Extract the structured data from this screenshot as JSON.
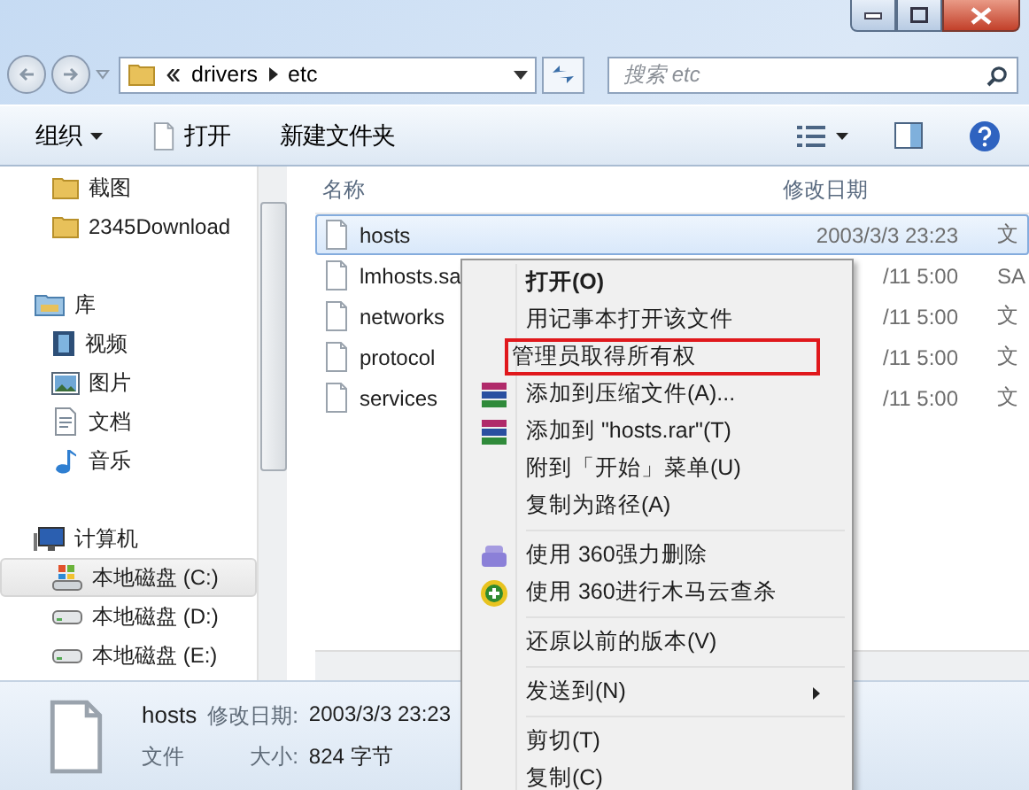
{
  "address_bar": {
    "path": [
      "drivers",
      "etc"
    ]
  },
  "search": {
    "placeholder": "搜索 etc"
  },
  "toolbar": {
    "items": [
      {
        "label": "组织",
        "kind": "menu"
      },
      {
        "label": "打开",
        "kind": "open"
      },
      {
        "label": "新建文件夹",
        "kind": "plain"
      }
    ]
  },
  "sidebar": {
    "groups": [
      {
        "items": [
          {
            "label": "截图",
            "kind": "folder",
            "selected": false
          },
          {
            "label": "2345Download",
            "kind": "folder",
            "selected": false
          }
        ]
      },
      {
        "items": [
          {
            "label": "库",
            "kind": "library",
            "selected": false
          },
          {
            "label": "视频",
            "kind": "video",
            "selected": false
          },
          {
            "label": "图片",
            "kind": "picture",
            "selected": false
          },
          {
            "label": "文档",
            "kind": "document",
            "selected": false
          },
          {
            "label": "音乐",
            "kind": "music",
            "selected": false
          }
        ]
      },
      {
        "items": [
          {
            "label": "计算机",
            "kind": "computer",
            "selected": false
          },
          {
            "label": "本地磁盘 (C:)",
            "kind": "system-drive",
            "selected": true
          },
          {
            "label": "本地磁盘 (D:)",
            "kind": "drive",
            "selected": false
          },
          {
            "label": "本地磁盘 (E:)",
            "kind": "drive",
            "selected": false
          }
        ]
      }
    ]
  },
  "file_list": {
    "columns": [
      "名称",
      "修改日期"
    ],
    "rows": [
      {
        "name": "hosts",
        "modified": "2003/3/3 23:23",
        "column_3": "文",
        "selected": true
      },
      {
        "name": "lmhosts.sa",
        "modified": "/11 5:00",
        "column_3": "SA",
        "selected": false
      },
      {
        "name": "networks",
        "modified": "/11 5:00",
        "column_3": "文",
        "selected": false
      },
      {
        "name": "protocol",
        "modified": "/11 5:00",
        "column_3": "文",
        "selected": false
      },
      {
        "name": "services",
        "modified": "/11 5:00",
        "column_3": "文",
        "selected": false
      }
    ]
  },
  "context_menu": {
    "items": [
      {
        "kind": "item",
        "label": "打开(O)",
        "default": true
      },
      {
        "kind": "item",
        "label": "用记事本打开该文件"
      },
      {
        "kind": "item",
        "label": "管理员取得所有权",
        "outlined": true
      },
      {
        "kind": "archive-item",
        "label": "添加到压缩文件(A)..."
      },
      {
        "kind": "archive-item",
        "label": "添加到 \"hosts.rar\"(T)"
      },
      {
        "kind": "item",
        "label": "附到「开始」菜单(U)"
      },
      {
        "kind": "item",
        "label": "复制为路径(A)"
      },
      {
        "kind": "separator"
      },
      {
        "kind": "shredder-item",
        "label": "使用 360强力删除"
      },
      {
        "kind": "scan-item",
        "label": "使用 360进行木马云查杀"
      },
      {
        "kind": "separator"
      },
      {
        "kind": "item",
        "label": "还原以前的版本(V)"
      },
      {
        "kind": "separator"
      },
      {
        "kind": "item",
        "label": "发送到(N)",
        "submenu": true
      },
      {
        "kind": "separator"
      },
      {
        "kind": "item",
        "label": "剪切(T)"
      },
      {
        "kind": "item",
        "label": "复制(C)"
      }
    ]
  },
  "details": {
    "name": "hosts",
    "modified_label": "修改日期:",
    "modified": "2003/3/3 23:23",
    "type": "文件",
    "size_label": "大小:",
    "size": "824 字节"
  }
}
